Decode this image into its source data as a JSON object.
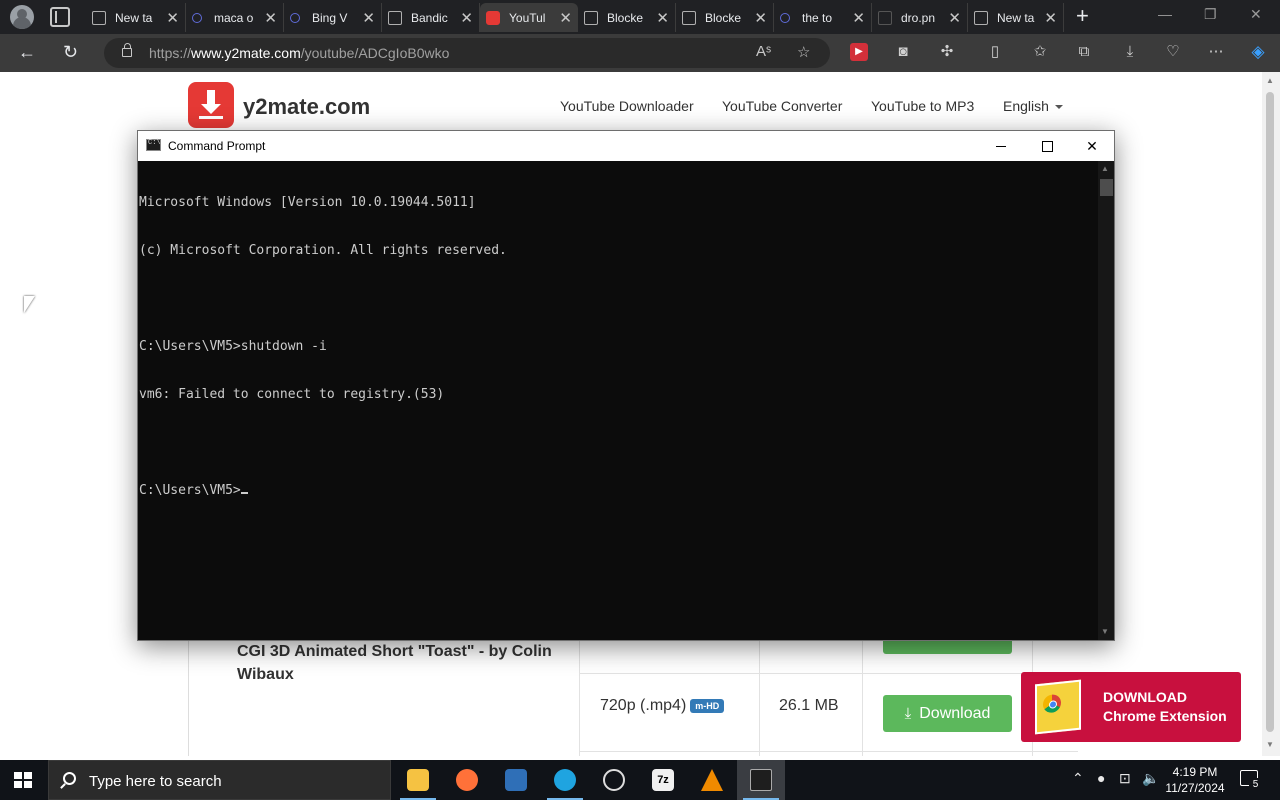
{
  "browser": {
    "tabs": [
      {
        "label": "New ta",
        "icon": "page-icon"
      },
      {
        "label": "maca o",
        "icon": "search-icon"
      },
      {
        "label": "Bing V",
        "icon": "search-icon"
      },
      {
        "label": "Bandic",
        "icon": "page-icon"
      },
      {
        "label": "YouTul",
        "icon": "y2mate-icon",
        "active": true
      },
      {
        "label": "Blocke",
        "icon": "page-icon"
      },
      {
        "label": "Blocke",
        "icon": "page-icon"
      },
      {
        "label": "the to",
        "icon": "search-icon"
      },
      {
        "label": "dro.pn",
        "icon": "faded-icon"
      },
      {
        "label": "New ta",
        "icon": "page-icon"
      }
    ],
    "tab_close_glyph": "✕",
    "new_tab_glyph": "+",
    "address": {
      "scheme": "https://",
      "host": "www.y2mate.com",
      "path": "/youtube/ADCgIoB0wko"
    },
    "window_controls": {
      "minimize": "—",
      "restore": "❐",
      "close": "✕"
    }
  },
  "site": {
    "name": "y2mate.com",
    "nav": [
      "YouTube Downloader",
      "YouTube Converter",
      "YouTube to MP3",
      "English"
    ],
    "video_title": "CGI 3D Animated Short \"Toast\" - by Colin Wibaux",
    "result": {
      "quality": "720p (.mp4)",
      "badge": "m-HD",
      "size": "26.1 MB",
      "download_label": "Download"
    },
    "extension_banner": {
      "line1": "DOWNLOAD",
      "line2": "Chrome Extension"
    },
    "accent_color": "#e53935",
    "download_color": "#5cb85c",
    "banner_color": "#c8103e"
  },
  "cmd": {
    "title": "Command Prompt",
    "close_glyph": "✕",
    "lines": [
      "Microsoft Windows [Version 10.0.19044.5011]",
      "(c) Microsoft Corporation. All rights reserved.",
      "",
      "C:\\Users\\VM5>shutdown -i",
      "vm6: Failed to connect to registry.(53)",
      ""
    ],
    "prompt": "C:\\Users\\VM5>"
  },
  "taskbar": {
    "search_placeholder": "Type here to search",
    "apps": [
      {
        "name": "file-explorer-icon",
        "color": "#f5c242"
      },
      {
        "name": "firefox-icon",
        "color": "#ff7139"
      },
      {
        "name": "media-player-icon",
        "color": "#2f6fb7"
      },
      {
        "name": "edge-icon",
        "color": "#1fa4e0"
      },
      {
        "name": "clock-app-icon",
        "color": "#d23b3b"
      },
      {
        "name": "7zip-icon",
        "color": "#f0f0f0"
      },
      {
        "name": "vlc-icon",
        "color": "#f08a00"
      },
      {
        "name": "command-prompt-icon",
        "color": "#1e1e1e"
      }
    ],
    "time": "4:19 PM",
    "date": "11/27/2024",
    "notification_count": "5"
  }
}
